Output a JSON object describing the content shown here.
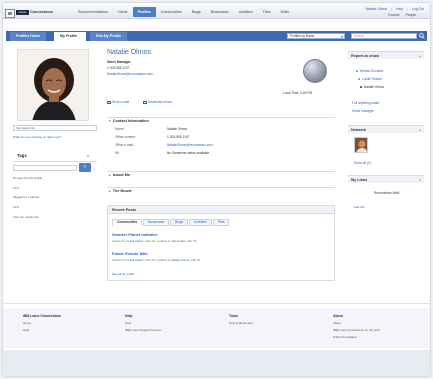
{
  "header": {
    "brand_badge": "Lotus",
    "brand_name": "Connections",
    "nav": [
      "Recommendations",
      "Home",
      "Profiles",
      "Communities",
      "Blogs",
      "Bookmarks",
      "Activities",
      "Files",
      "Wikis",
      "Forums"
    ],
    "active_nav": "Profiles",
    "user_links": [
      "Natalie Olmos",
      "Help",
      "Log Out"
    ],
    "sub_links": [
      "Forums",
      "People"
    ]
  },
  "tabs": {
    "directory": "Profiles Home",
    "my_profile": "My Profile",
    "edit": "Edit My Profile",
    "directory_select": "Profiles by Name",
    "search_placeholder": "Search",
    "search_icon": "magnifier-icon"
  },
  "profile": {
    "name": "Natalie Olmos",
    "title": "Sales Manager",
    "phone": "1-304-555-1107",
    "email": "NatalieOlmos@renovations.com",
    "local_time": "Local Time: 3:25 PM",
    "send_email": "Send e-mail",
    "download_vcard": "Download vCard"
  },
  "left": {
    "status_placeholder": "Set status info",
    "status_help": "What are you working on right now?",
    "tags_title": "Tags",
    "no_tags": "No tags for this profile",
    "find_label": "Find",
    "tagged_by": "Tagged by 1 person",
    "find_label_2": "Find",
    "view_as": "View as: cloud | list"
  },
  "contact": {
    "heading": "Contact Information",
    "rows": [
      {
        "k": "Name:",
        "v": "Natalie Olmos",
        "link": false
      },
      {
        "k": "Office number:",
        "v": "1-304-555-1107",
        "link": false
      },
      {
        "k": "Office e-mail:",
        "v": "NatalieOlmos@renovations.com",
        "link": true
      },
      {
        "k": "IM:",
        "v": "No Sametime status available",
        "link": false
      }
    ]
  },
  "about_heading": "About Me",
  "board_heading": "The Board",
  "recent": {
    "heading": "Recent Posts",
    "tabs": [
      "Communities",
      "Bookmarks",
      "Blogs",
      "Activities",
      "Files"
    ],
    "posts": [
      {
        "title": "Smarter Planet Initiative",
        "meta_prefix": "Updated by",
        "meta_by": "Frank Adams",
        "meta_rest": "| Mar 29 | updated by",
        "meta_by2": "Ted Amado",
        "meta_end": "| Mar 25"
      },
      {
        "title": "Public Events Wiki",
        "meta_prefix": "Updated by",
        "meta_by": "Frank Adams",
        "meta_rest": "| Mar 29 | updated by",
        "meta_by2": "Natalie Olmos",
        "meta_end": "| Mar 25"
      }
    ],
    "see_all": "See all for profile"
  },
  "right": {
    "report_heading": "Report-to chain",
    "chain": [
      "Dennis Goodwin",
      "Lucille Suarez",
      "Natalie Olmos"
    ],
    "full_chain": "Full reporting chain",
    "same_manager": "Same manager",
    "network_heading": "Network",
    "show_all": "Show all (1)",
    "links_heading": "My Links",
    "links_item": "Renovations Wiki!",
    "links_add": "Add link"
  },
  "footer": {
    "cols": [
      {
        "h": "IBM Lotus Connections",
        "items": [
          "Home",
          "Help"
        ]
      },
      {
        "h": "Help",
        "items": [
          "Help",
          "IBM Lotus Support Forums"
        ]
      },
      {
        "h": "Tools",
        "items": [
          "How to Bookmark"
        ]
      },
      {
        "h": "About",
        "items": [
          "About",
          "IBM Lotus Connections on the web",
          "Submit Feedback"
        ]
      }
    ]
  },
  "colors": {
    "accent": "#3f69ad",
    "link": "#2a63b8",
    "name": "#3f6fb3"
  }
}
